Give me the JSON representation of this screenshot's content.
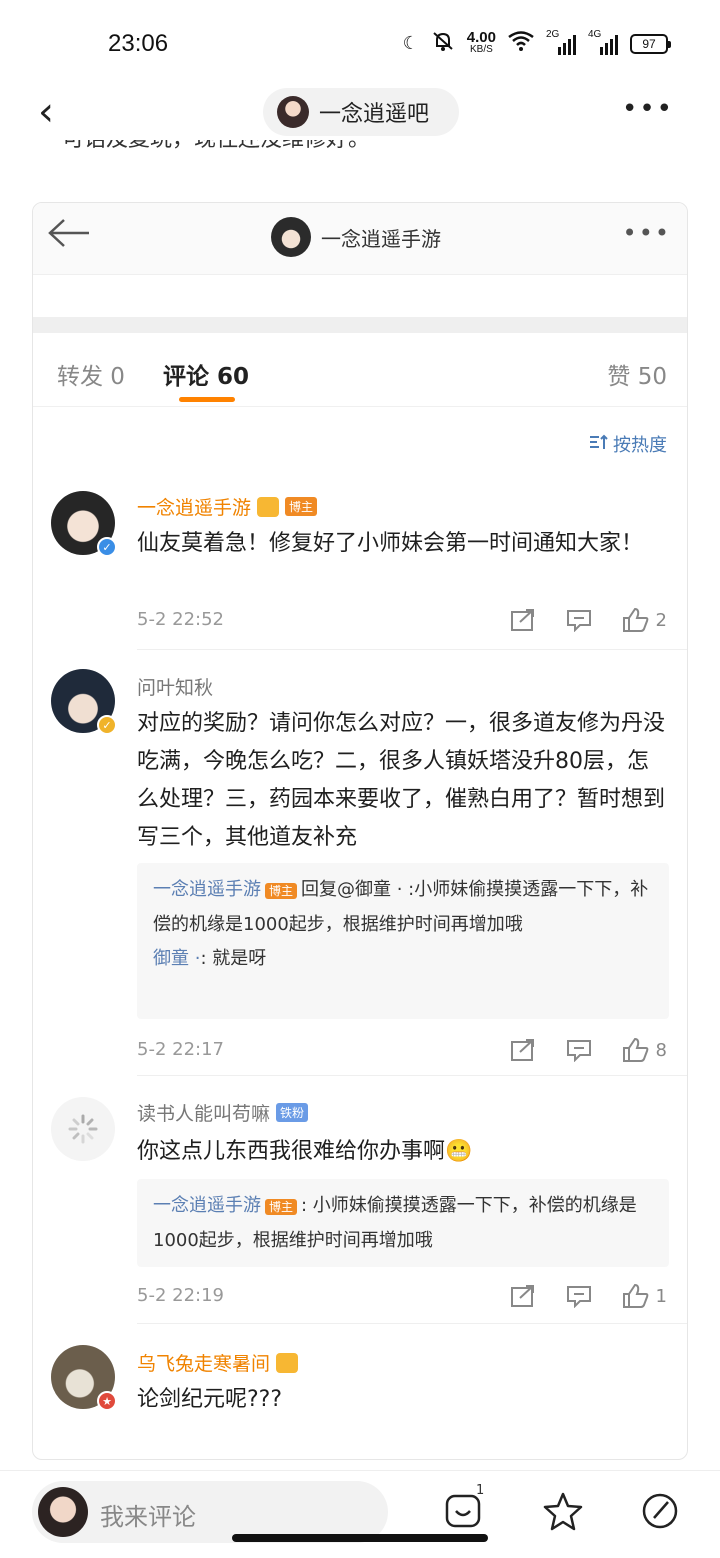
{
  "status": {
    "time": "23:06",
    "net_speed_value": "4.00",
    "net_speed_unit": "KB/S",
    "sim1": "2G",
    "sim2": "4G",
    "battery": "97"
  },
  "header": {
    "back_icon": "back-chevron-icon",
    "forum_title": "一念逍遥吧",
    "more_icon": "more-dots-icon"
  },
  "cut_text": "可话及复玩，现住还没维修好。",
  "card": {
    "back_icon": "back-arrow-icon",
    "title": "一念逍遥手游",
    "tabs": {
      "repost": "转发 0",
      "comments": "评论 60",
      "likes": "赞 50"
    },
    "sort_label": "按热度",
    "comments": [
      {
        "name": "一念逍遥手游",
        "tag": "博主",
        "text": "仙友莫着急！修复好了小师妹会第一时间通知大家！",
        "time": "5-2 22:52",
        "likes": "2"
      },
      {
        "name": "问叶知秋",
        "text": "对应的奖励？请问你怎么对应？一，很多道友修为丹没吃满，今晚怎么吃？二，很多人镇妖塔没升80层，怎么处理？三，药园本来要收了，催熟白用了？暂时想到写三个，其他道友补充",
        "reply_name": "一念逍遥手游",
        "reply_tag": "博主",
        "reply_text": "回复@御童 · :小师妹偷摸摸透露一下下，补偿的机缘是1000起步，根据维护时间再增加哦",
        "reply2_name": "御童 ·",
        "reply2_text": ": 就是呀",
        "time": "5-2 22:17",
        "likes": "8"
      },
      {
        "name": "读书人能叫苟嘛",
        "tag": "铁粉",
        "text": "你这点儿东西我很难给你办事啊😬",
        "reply_name": "一念逍遥手游",
        "reply_tag": "博主",
        "reply_text": ": 小师妹偷摸摸透露一下下，补偿的机缘是1000起步，根据维护时间再增加哦",
        "time": "5-2 22:19",
        "likes": "1"
      },
      {
        "name": "乌飞兔走寒暑间",
        "text": "论剑纪元呢???"
      }
    ]
  },
  "bottom": {
    "input_placeholder": "我来评论",
    "emoji_count": "1"
  },
  "colors": {
    "accent_orange": "#ff8200",
    "link_blue": "#5b7fb3",
    "owner_tag": "#f08a24",
    "fan_tag": "#6a9be6"
  }
}
